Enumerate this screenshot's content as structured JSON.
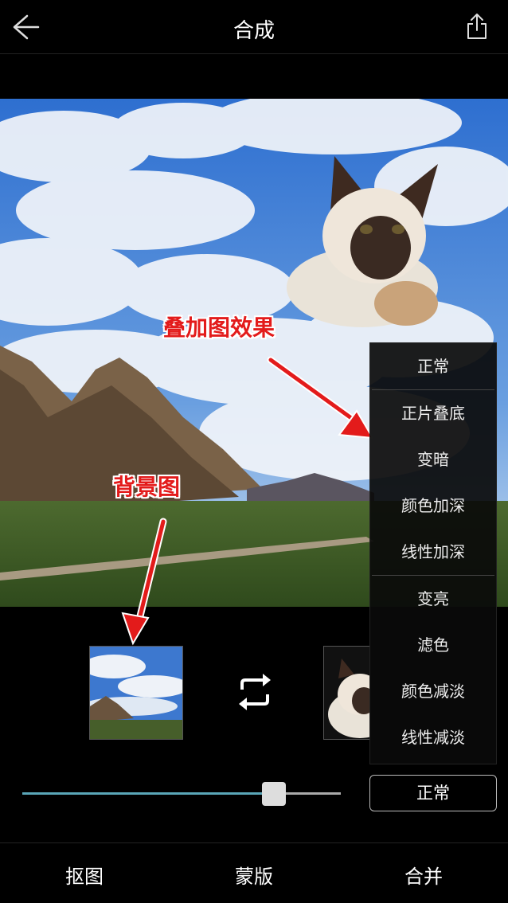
{
  "header": {
    "title": "合成"
  },
  "annotations": {
    "overlay_label": "叠加图效果",
    "background_label": "背景图"
  },
  "blend_menu": {
    "items": [
      "正常",
      "正片叠底",
      "变暗",
      "颜色加深",
      "线性加深",
      "变亮",
      "滤色",
      "颜色减淡",
      "线性减淡"
    ]
  },
  "controls": {
    "opacity_fraction": 0.79,
    "blend_mode_button": "正常"
  },
  "footer": {
    "tabs": [
      "抠图",
      "蒙版",
      "合并"
    ]
  }
}
